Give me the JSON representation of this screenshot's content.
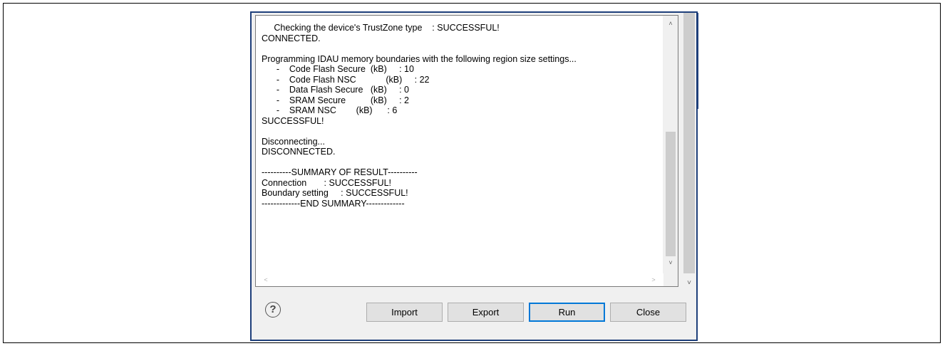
{
  "log": {
    "lines": [
      "     Checking the device's TrustZone type    : SUCCESSFUL!",
      "CONNECTED.",
      "",
      "Programming IDAU memory boundaries with the following region size settings...",
      "      -    Code Flash Secure  (kB)     : 10",
      "      -    Code Flash NSC            (kB)     : 22",
      "      -    Data Flash Secure   (kB)     : 0",
      "      -    SRAM Secure          (kB)     : 2",
      "      -    SRAM NSC        (kB)      : 6",
      "SUCCESSFUL!",
      "",
      "Disconnecting...",
      "DISCONNECTED.",
      "",
      "----------SUMMARY OF RESULT----------",
      "Connection       : SUCCESSFUL!",
      "Boundary setting     : SUCCESSFUL!",
      "-------------END SUMMARY-------------"
    ]
  },
  "buttons": {
    "import": "Import",
    "export": "Export",
    "run": "Run",
    "close": "Close"
  },
  "help": {
    "glyph": "?"
  },
  "scroll": {
    "up": "˄",
    "down": "˅",
    "left": "˂",
    "right": "˃",
    "outer_down": "˅"
  }
}
